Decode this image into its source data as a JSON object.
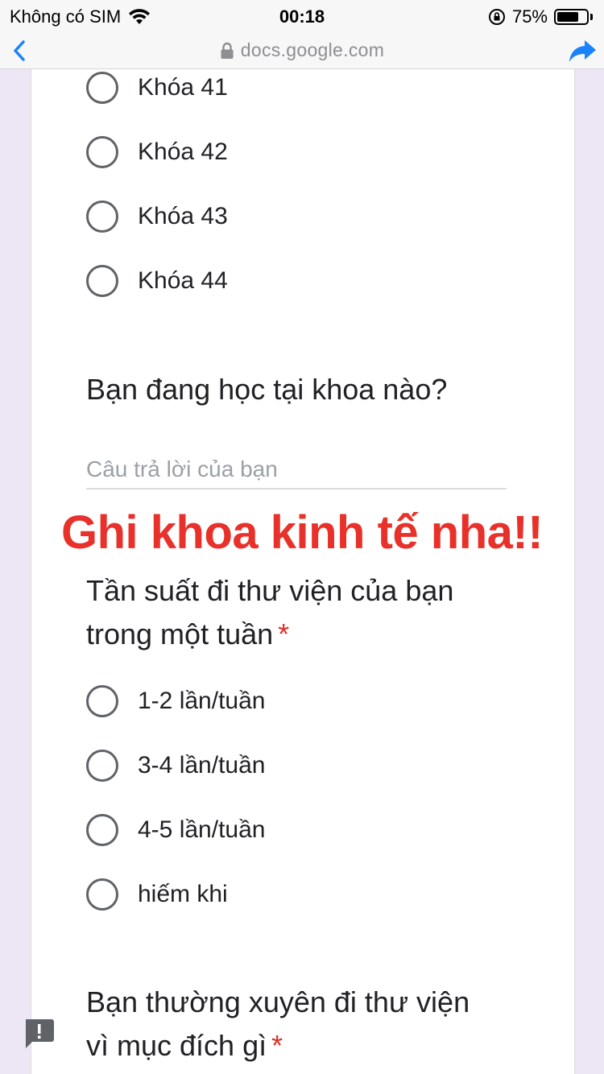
{
  "status_bar": {
    "carrier": "Không có SIM",
    "time": "00:18",
    "battery": "75%",
    "battery_level": 0.75,
    "icons": [
      "wifi-icon",
      "rotation-lock-icon",
      "battery-icon"
    ]
  },
  "nav_bar": {
    "url": "docs.google.com",
    "icons": [
      "back-chevron-icon",
      "padlock-icon",
      "share-arrow-icon"
    ]
  },
  "form": {
    "course_options": [
      "Khóa 41",
      "Khóa 42",
      "Khóa 43",
      "Khóa 44"
    ],
    "faculty_question": "Bạn đang học tại khoa nào?",
    "faculty_placeholder": "Câu trả lời của bạn",
    "frequency_question_line1": "Tần suất đi thư viện của bạn",
    "frequency_question_line2": "trong một tuần",
    "required_mark": "*",
    "frequency_options": [
      "1-2 lần/tuần",
      "3-4 lần/tuần",
      "4-5 lần/tuần",
      "hiếm khi"
    ],
    "purpose_question_line1": "Bạn thường xuyên đi thư viện",
    "purpose_question_line2": "vì mục đích gì"
  },
  "overlay_note": "Ghi khoa kinh tế nha!!",
  "colors": {
    "background": "#ece6f5",
    "accent_blue": "#1a82fb",
    "overlay_red": "#e8312a",
    "required_red": "#d93025"
  }
}
